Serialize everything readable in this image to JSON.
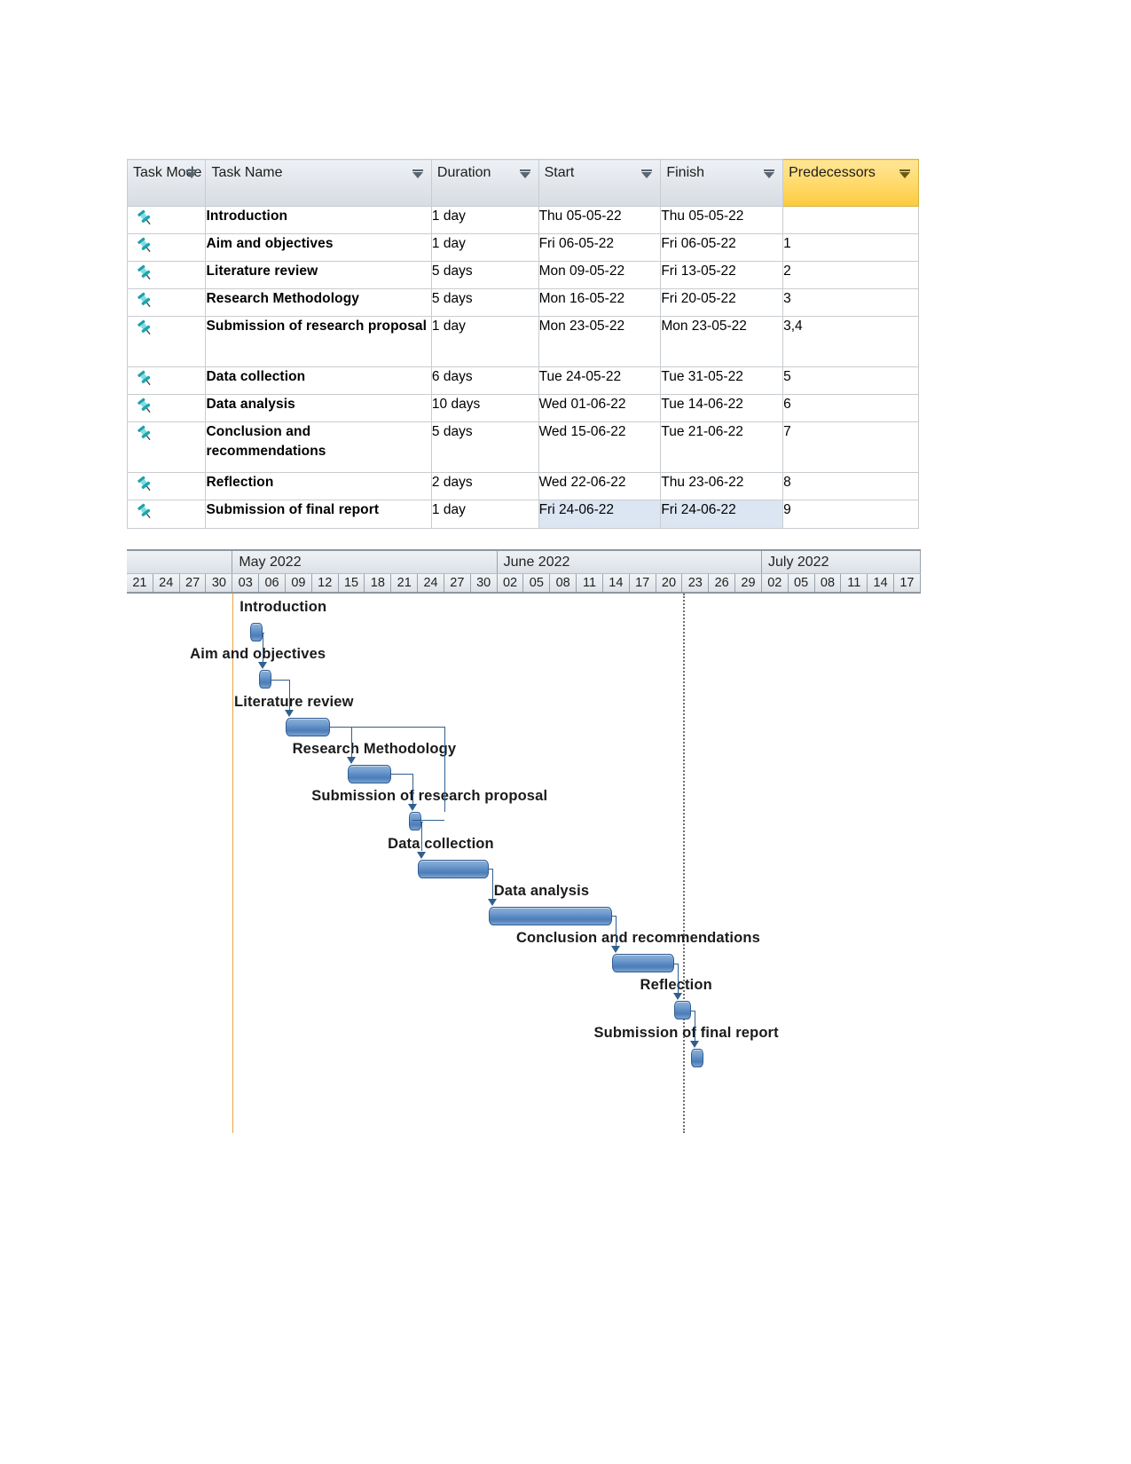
{
  "table": {
    "columns": [
      {
        "key": "task_mode",
        "label": "Task Mode",
        "highlight": false
      },
      {
        "key": "task_name",
        "label": "Task Name",
        "highlight": false
      },
      {
        "key": "duration",
        "label": "Duration",
        "highlight": false
      },
      {
        "key": "start",
        "label": "Start",
        "highlight": false
      },
      {
        "key": "finish",
        "label": "Finish",
        "highlight": false
      },
      {
        "key": "predecessors",
        "label": "Predecessors",
        "highlight": true
      }
    ],
    "rows": [
      {
        "id": 1,
        "mode_icon": "pushpin-icon",
        "task_name": "Introduction",
        "duration": "1 day",
        "start": "Thu 05-05-22",
        "finish": "Thu 05-05-22",
        "predecessors": "",
        "selected": false
      },
      {
        "id": 2,
        "mode_icon": "pushpin-icon",
        "task_name": "Aim and objectives",
        "duration": "1 day",
        "start": "Fri 06-05-22",
        "finish": "Fri 06-05-22",
        "predecessors": "1",
        "selected": false
      },
      {
        "id": 3,
        "mode_icon": "pushpin-icon",
        "task_name": "Literature review",
        "duration": "5 days",
        "start": "Mon 09-05-22",
        "finish": "Fri 13-05-22",
        "predecessors": "2",
        "selected": false
      },
      {
        "id": 4,
        "mode_icon": "pushpin-icon",
        "task_name": "Research Methodology",
        "duration": "5 days",
        "start": "Mon 16-05-22",
        "finish": "Fri 20-05-22",
        "predecessors": "3",
        "selected": false
      },
      {
        "id": 5,
        "mode_icon": "pushpin-icon",
        "task_name": "Submission of research proposal",
        "duration": "1 day",
        "start": "Mon 23-05-22",
        "finish": "Mon 23-05-22",
        "predecessors": "3,4",
        "selected": false
      },
      {
        "id": 6,
        "mode_icon": "pushpin-icon",
        "task_name": "Data collection",
        "duration": "6 days",
        "start": "Tue 24-05-22",
        "finish": "Tue 31-05-22",
        "predecessors": "5",
        "selected": false
      },
      {
        "id": 7,
        "mode_icon": "pushpin-icon",
        "task_name": "Data analysis",
        "duration": "10 days",
        "start": "Wed 01-06-22",
        "finish": "Tue 14-06-22",
        "predecessors": "6",
        "selected": false
      },
      {
        "id": 8,
        "mode_icon": "pushpin-icon",
        "task_name": "Conclusion and recommendations",
        "duration": "5 days",
        "start": "Wed 15-06-22",
        "finish": "Tue 21-06-22",
        "predecessors": "7",
        "selected": false
      },
      {
        "id": 9,
        "mode_icon": "pushpin-icon",
        "task_name": "Reflection",
        "duration": "2 days",
        "start": "Wed 22-06-22",
        "finish": "Thu 23-06-22",
        "predecessors": "8",
        "selected": false
      },
      {
        "id": 10,
        "mode_icon": "pushpin-icon",
        "task_name": "Submission of final report",
        "duration": "1 day",
        "start": "Fri 24-06-22",
        "finish": "Fri 24-06-22",
        "predecessors": "9",
        "selected": true
      }
    ]
  },
  "timeline": {
    "months": [
      {
        "label": "",
        "span": 4
      },
      {
        "label": "May 2022",
        "span": 10
      },
      {
        "label": "June 2022",
        "span": 10
      },
      {
        "label": "July 2022",
        "span": 6
      }
    ],
    "days": [
      "21",
      "24",
      "27",
      "30",
      "03",
      "06",
      "09",
      "12",
      "15",
      "18",
      "21",
      "24",
      "27",
      "30",
      "02",
      "05",
      "08",
      "11",
      "14",
      "17",
      "20",
      "23",
      "26",
      "29",
      "02",
      "05",
      "08",
      "11",
      "14",
      "17"
    ]
  },
  "chart_data": {
    "type": "gantt",
    "title": "",
    "xlabel": "",
    "ylabel": "",
    "axis_start": "2022-04-21",
    "axis_end": "2022-07-18",
    "tick_interval_days": 3,
    "today_marker": "2022-05-03",
    "status_marker": "2022-06-23",
    "tasks": [
      {
        "id": 1,
        "name": "Introduction",
        "start": "2022-05-05",
        "finish": "2022-05-05",
        "duration_days": 1,
        "predecessors": [],
        "bar_left_pct": 15.9,
        "bar_width_pct": 1.3
      },
      {
        "id": 2,
        "name": "Aim and objectives",
        "start": "2022-05-06",
        "finish": "2022-05-06",
        "duration_days": 1,
        "predecessors": [
          1
        ],
        "bar_left_pct": 17.2,
        "bar_width_pct": 1.3
      },
      {
        "id": 3,
        "name": "Literature review",
        "start": "2022-05-09",
        "finish": "2022-05-13",
        "duration_days": 5,
        "predecessors": [
          2
        ],
        "bar_left_pct": 20.5,
        "bar_width_pct": 5.3
      },
      {
        "id": 4,
        "name": "Research Methodology",
        "start": "2022-05-16",
        "finish": "2022-05-20",
        "duration_days": 5,
        "predecessors": [
          3
        ],
        "bar_left_pct": 28.1,
        "bar_width_pct": 5.3
      },
      {
        "id": 5,
        "name": "Submission of research proposal",
        "start": "2022-05-23",
        "finish": "2022-05-23",
        "duration_days": 1,
        "predecessors": [
          3,
          4
        ],
        "bar_left_pct": 35.7,
        "bar_width_pct": 1.3
      },
      {
        "id": 6,
        "name": "Data collection",
        "start": "2022-05-24",
        "finish": "2022-05-31",
        "duration_days": 6,
        "predecessors": [
          5
        ],
        "bar_left_pct": 37.0,
        "bar_width_pct": 7.5
      },
      {
        "id": 7,
        "name": "Data analysis",
        "start": "2022-06-01",
        "finish": "2022-06-14",
        "duration_days": 10,
        "predecessors": [
          6
        ],
        "bar_left_pct": 45.6,
        "bar_width_pct": 15.0
      },
      {
        "id": 8,
        "name": "Conclusion and recommendations",
        "start": "2022-06-15",
        "finish": "2022-06-21",
        "duration_days": 5,
        "predecessors": [
          7
        ],
        "bar_left_pct": 61.0,
        "bar_width_pct": 7.5
      },
      {
        "id": 9,
        "name": "Reflection",
        "start": "2022-06-22",
        "finish": "2022-06-23",
        "duration_days": 2,
        "predecessors": [
          8
        ],
        "bar_left_pct": 68.7,
        "bar_width_pct": 2.6
      },
      {
        "id": 10,
        "name": "Submission of final report",
        "start": "2022-06-24",
        "finish": "2022-06-24",
        "duration_days": 1,
        "predecessors": [
          9
        ],
        "bar_left_pct": 71.3,
        "bar_width_pct": 1.3
      }
    ]
  },
  "colors": {
    "bar_fill": "#5a8bc4",
    "bar_border": "#2f5c93",
    "link_line": "#315f8e",
    "predecessor_header": "#ffd968",
    "selection": "#dce6f2",
    "today_line": "#e8a33d",
    "status_line": "#6f6f6f"
  }
}
